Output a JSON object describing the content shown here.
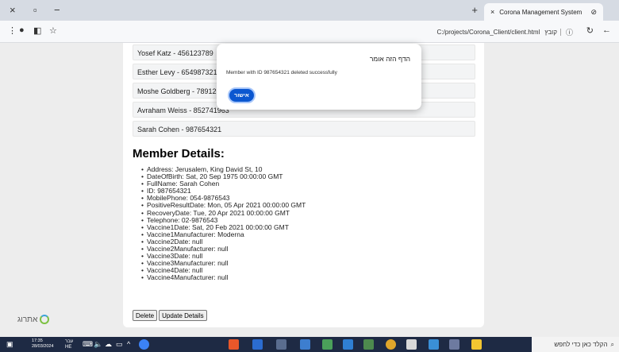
{
  "browser": {
    "tab_title": "Corona Management System",
    "tab_close_glyph": "×",
    "window_controls": [
      "×",
      "▫",
      "−"
    ],
    "new_tab_glyph": "+",
    "url": "C:/projects/Corona_Client/client.html",
    "url_chip": "קובץ"
  },
  "members": [
    "Yosef Katz - 456123789",
    "Esther Levy - 654987321",
    "Moshe Goldberg - 789123456",
    "Avraham Weiss - 852741963",
    "Sarah Cohen - 987654321"
  ],
  "details": {
    "title": "Member Details:",
    "items": [
      "Address: Jerusalem, King David St, 10",
      "DateOfBirth: Sat, 20 Sep 1975 00:00:00 GMT",
      "FullName: Sarah Cohen",
      "ID: 987654321",
      "MobilePhone: 054-9876543",
      "PositiveResultDate: Mon, 05 Apr 2021 00:00:00 GMT",
      "RecoveryDate: Tue, 20 Apr 2021 00:00:00 GMT",
      "Telephone: 02-9876543",
      "Vaccine1Date: Sat, 20 Feb 2021 00:00:00 GMT",
      "Vaccine1Manufacturer: Moderna",
      "Vaccine2Date: null",
      "Vaccine2Manufacturer: null",
      "Vaccine3Date: null",
      "Vaccine3Manufacturer: null",
      "Vaccine4Date: null",
      "Vaccine4Manufacturer: null"
    ],
    "delete_label": "Delete",
    "update_label": "Update Details"
  },
  "dialog": {
    "title": "הדף הזה אומר",
    "message": "Member with ID 987654321 deleted successfully",
    "ok_label": "אישור"
  },
  "logo_text": "אתרוג",
  "taskbar": {
    "time": "17:35",
    "date": "28/03/2024",
    "lang_top": "עבר",
    "lang_bottom": "HE",
    "search_placeholder": "הקלד כאן כדי לחפש"
  },
  "colors": {
    "accent": "#0b57d0",
    "taskbar": "#1e2a44"
  }
}
